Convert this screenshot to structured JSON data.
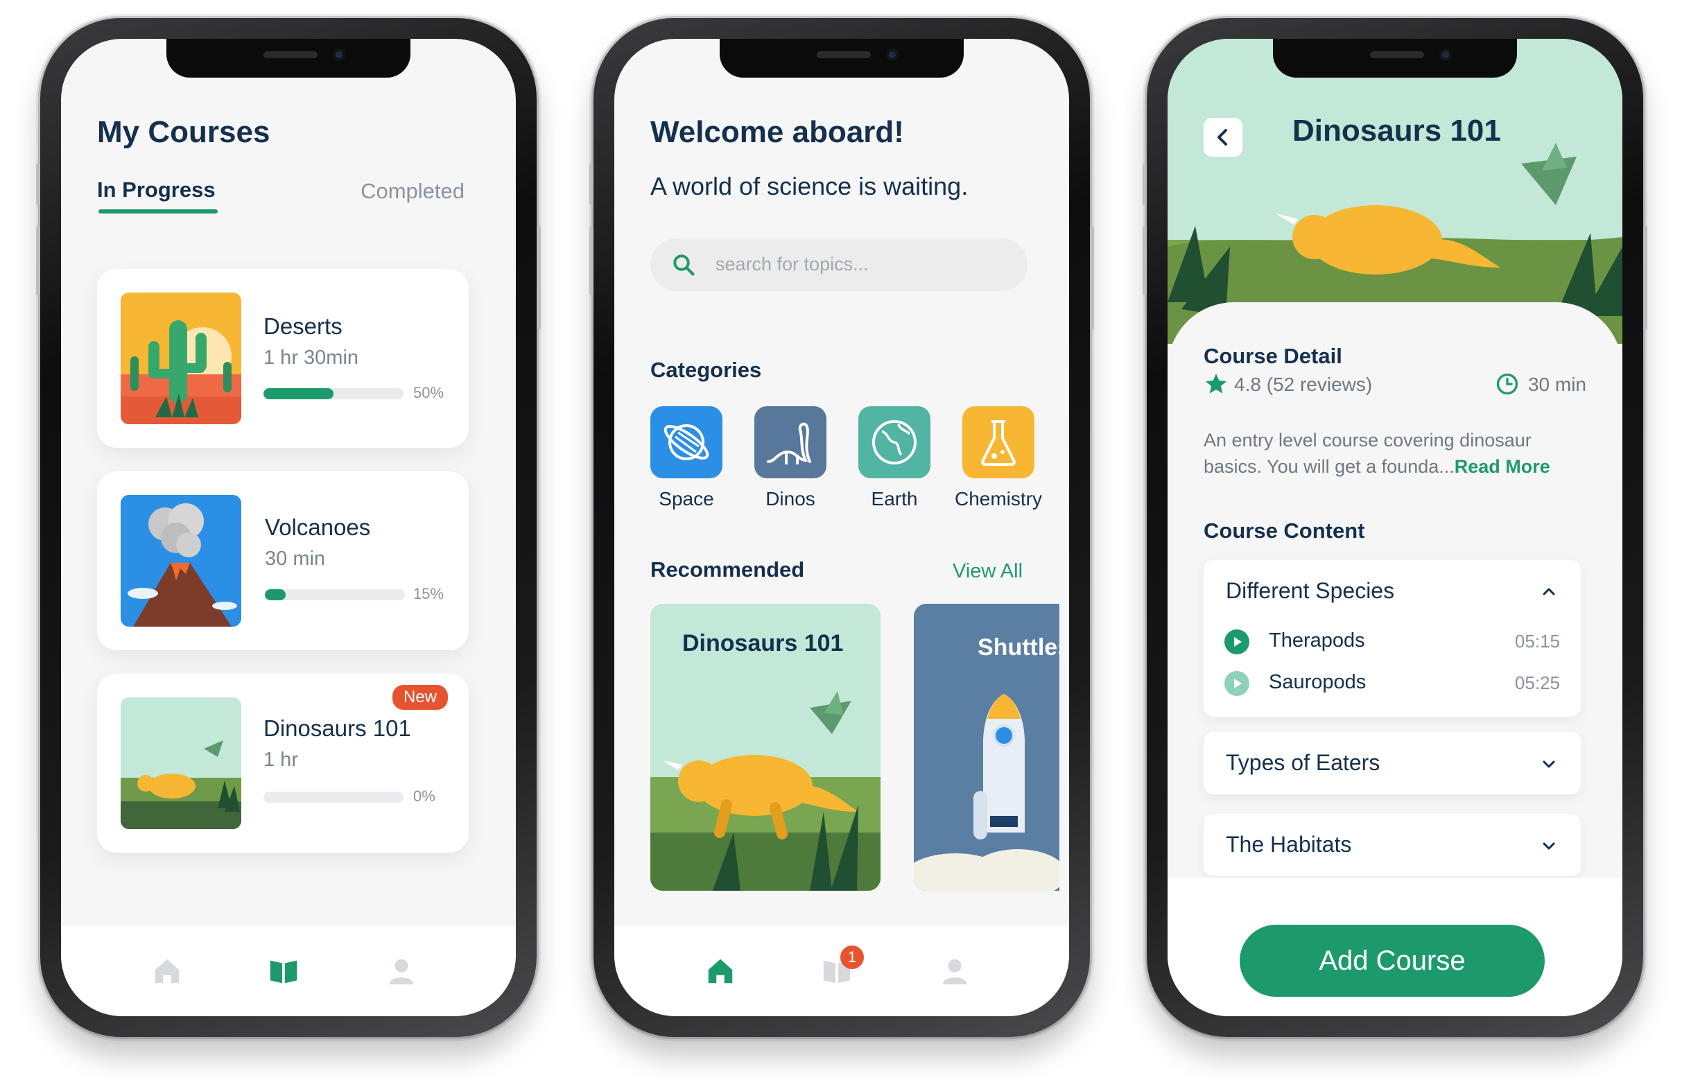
{
  "colors": {
    "accent": "#1d9a6c",
    "dark_text": "#14304d",
    "badge": "#e8532f",
    "muted": "#8a939c"
  },
  "my_courses": {
    "title": "My Courses",
    "tabs": {
      "in_progress": "In Progress",
      "completed": "Completed"
    },
    "courses": [
      {
        "name": "Deserts",
        "duration": "1 hr 30min",
        "progress": 0.5,
        "progress_label": "50%"
      },
      {
        "name": "Volcanoes",
        "duration": "30 min",
        "progress": 0.15,
        "progress_label": "15%"
      },
      {
        "name": "Dinosaurs 101",
        "duration": "1 hr",
        "progress": 0,
        "progress_label": "0%",
        "badge": "New"
      }
    ],
    "tabbar": {
      "active": "courses-tab",
      "items": [
        "home-icon",
        "book-icon",
        "profile-icon"
      ]
    }
  },
  "welcome": {
    "title": "Welcome aboard!",
    "subtitle": "A world of science is waiting.",
    "search_placeholder": "search for topics...",
    "categories_heading": "Categories",
    "categories": [
      {
        "label": "Space",
        "color": "#2b8fe6",
        "icon": "planet-icon"
      },
      {
        "label": "Dinos",
        "color": "#58789b",
        "icon": "dinosaur-icon"
      },
      {
        "label": "Earth",
        "color": "#52b4a2",
        "icon": "globe-icon"
      },
      {
        "label": "Chemistry",
        "color": "#f7b733",
        "icon": "flask-icon"
      }
    ],
    "recommended_heading": "Recommended",
    "view_all": "View All",
    "recommended": [
      {
        "title": "Dinosaurs 101"
      },
      {
        "title": "Shuttles"
      }
    ],
    "tabbar": {
      "active": "home-tab",
      "notification_count": "1",
      "items": [
        "home-icon",
        "book-icon",
        "profile-icon"
      ]
    }
  },
  "detail": {
    "title": "Dinosaurs 101",
    "course_detail_heading": "Course Detail",
    "rating": "4.8 (52 reviews)",
    "duration": "30 min",
    "description": "An entry level course covering dinosaur basics. You will get a founda...",
    "read_more": "Read More",
    "course_content_heading": "Course Content",
    "sections": [
      {
        "title": "Different Species",
        "expanded": true,
        "lessons": [
          {
            "name": "Therapods",
            "time": "05:15"
          },
          {
            "name": "Sauropods",
            "time": "05:25"
          }
        ]
      },
      {
        "title": "Types of Eaters",
        "expanded": false
      },
      {
        "title": "The Habitats",
        "expanded": false
      }
    ],
    "add_course": "Add Course"
  }
}
